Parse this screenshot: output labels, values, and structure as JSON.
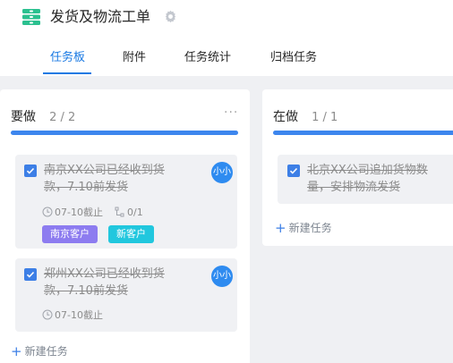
{
  "header": {
    "title": "发货及物流工单",
    "app_icon": "app-stack-icon",
    "settings_icon": "gear-icon",
    "accent": "#1b7ae3"
  },
  "tabs": [
    {
      "label": "任务板",
      "active": true
    },
    {
      "label": "附件",
      "active": false
    },
    {
      "label": "任务统计",
      "active": false
    },
    {
      "label": "归档任务",
      "active": false
    }
  ],
  "columns": [
    {
      "name": "要做",
      "count": "2 / 2",
      "more": "···",
      "bar_color": "#3d86ee",
      "new_task": "新建任务",
      "cards": [
        {
          "title_line1": "南京XX公司已经收到货",
          "title_line2": "款，7.10前发货",
          "checked": true,
          "avatar": "小小",
          "due": "07-10截止",
          "subtasks": "0/1",
          "tags": [
            {
              "label": "南京客户",
              "color": "#8d7cf0"
            },
            {
              "label": "新客户",
              "color": "#21c7de"
            }
          ]
        },
        {
          "title_line1": "郑州XX公司已经收到货",
          "title_line2": "款，7.10前发货",
          "checked": true,
          "avatar": "小小",
          "due": "07-10截止"
        }
      ]
    },
    {
      "name": "在做",
      "count": "1 / 1",
      "bar_color": "#3d86ee",
      "new_task": "新建任务",
      "cards": [
        {
          "title_line1": "北京XX公司追加货物数",
          "title_line2": "量，安排物流发货",
          "checked": true
        }
      ]
    }
  ]
}
